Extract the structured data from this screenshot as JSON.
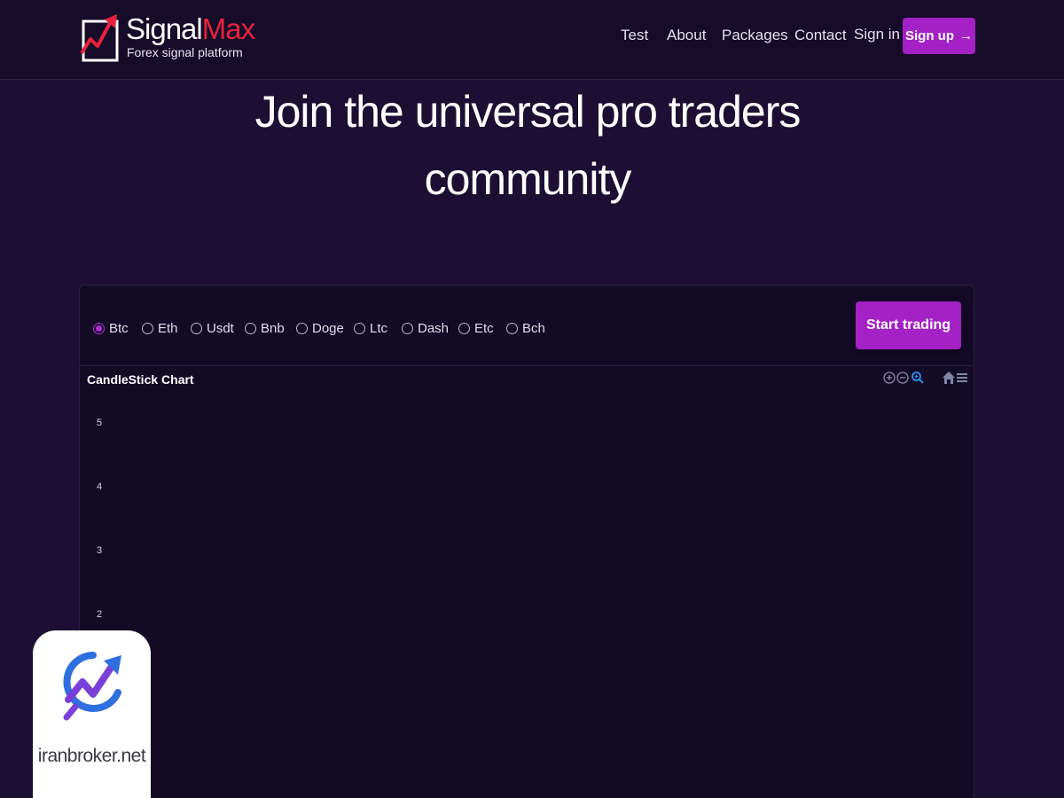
{
  "header": {
    "logo": {
      "name_main": "Signal",
      "name_accent": "Max",
      "tagline": "Forex signal platform",
      "accent_color": "#e6233c"
    },
    "nav": [
      {
        "label": "Test"
      },
      {
        "label": "About"
      },
      {
        "label": "Packages"
      },
      {
        "label": "Contact"
      },
      {
        "label": "Sign in"
      }
    ],
    "signup_label": "Sign up",
    "brand_color": "#a321c5"
  },
  "hero": {
    "line1": "Join the universal pro traders",
    "line2": "community"
  },
  "panel": {
    "coins": [
      {
        "label": "Btc",
        "checked": true
      },
      {
        "label": "Eth",
        "checked": false
      },
      {
        "label": "Usdt",
        "checked": false
      },
      {
        "label": "Bnb",
        "checked": false
      },
      {
        "label": "Doge",
        "checked": false
      },
      {
        "label": "Ltc",
        "checked": false
      },
      {
        "label": "Dash",
        "checked": false
      },
      {
        "label": "Etc",
        "checked": false
      },
      {
        "label": "Bch",
        "checked": false
      }
    ],
    "start_label": "Start trading",
    "toolbar_icons": [
      "zoom-in-icon",
      "zoom-out-icon",
      "search-icon",
      "home-icon",
      "menu-icon"
    ]
  },
  "chart_data": {
    "type": "candlestick",
    "title": "CandleStick Chart",
    "yticks": [
      "5",
      "4",
      "3",
      "2"
    ],
    "ylim": [
      0,
      5
    ],
    "series": []
  },
  "watermark": {
    "text": "iranbroker.net"
  }
}
